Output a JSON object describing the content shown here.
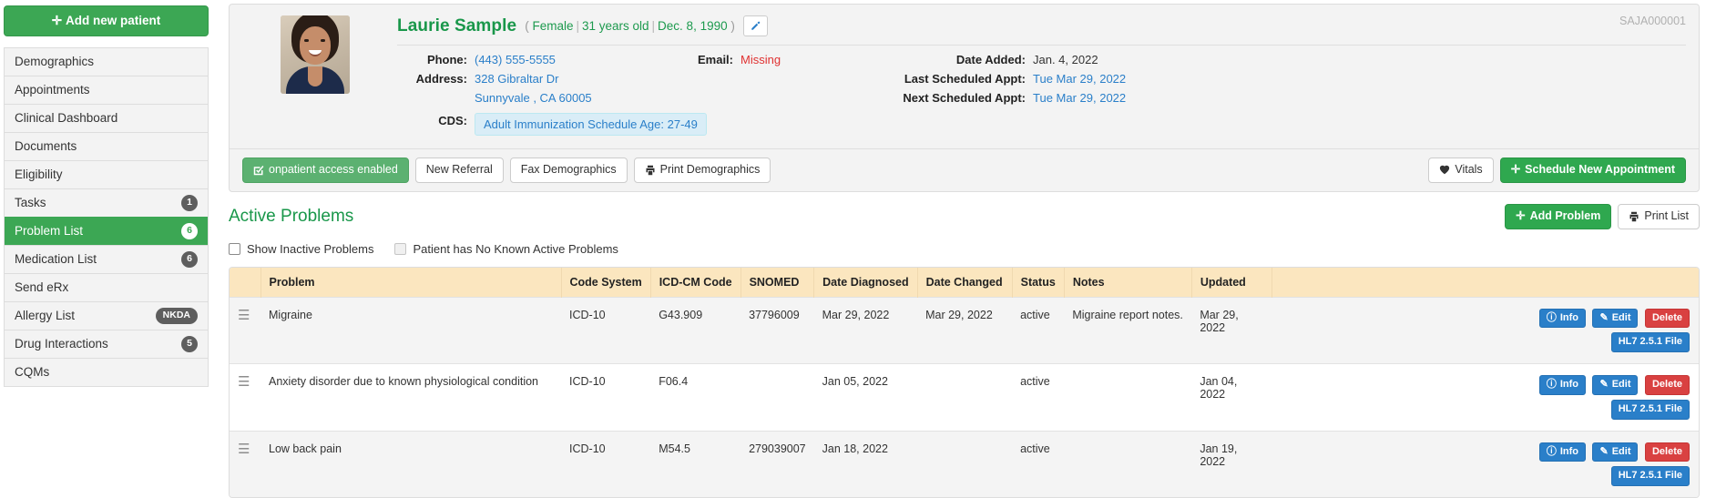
{
  "sidebar": {
    "add_patient_label": "Add new patient",
    "add_patient_plus": "✛",
    "items": [
      {
        "label": "Demographics",
        "badge": "",
        "active": false
      },
      {
        "label": "Appointments",
        "badge": "",
        "active": false
      },
      {
        "label": "Clinical Dashboard",
        "badge": "",
        "active": false
      },
      {
        "label": "Documents",
        "badge": "",
        "active": false
      },
      {
        "label": "Eligibility",
        "badge": "",
        "active": false
      },
      {
        "label": "Tasks",
        "badge": "1",
        "active": false
      },
      {
        "label": "Problem List",
        "badge": "6",
        "active": true
      },
      {
        "label": "Medication List",
        "badge": "6",
        "active": false
      },
      {
        "label": "Send eRx",
        "badge": "",
        "active": false
      },
      {
        "label": "Allergy List",
        "badge": "NKDA",
        "active": false
      },
      {
        "label": "Drug Interactions",
        "badge": "5",
        "active": false
      },
      {
        "label": "CQMs",
        "badge": "",
        "active": false
      }
    ]
  },
  "patient": {
    "name": "Laurie Sample",
    "paren_open": "(",
    "gender": "Female",
    "sep": "|",
    "age": "31 years old",
    "dob": "Dec. 8, 1990",
    "paren_close": ")",
    "chart_id": "SAJA000001",
    "labels": {
      "phone": "Phone:",
      "email": "Email:",
      "address": "Address:",
      "cds": "CDS:",
      "date_added": "Date Added:",
      "last_appt": "Last Scheduled Appt:",
      "next_appt": "Next Scheduled Appt:"
    },
    "phone": "(443) 555-5555",
    "email": "Missing",
    "address_line1": "328 Gibraltar Dr",
    "address_line2": "Sunnyvale , CA 60005",
    "cds": "Adult Immunization Schedule Age: 27-49",
    "date_added": "Jan. 4, 2022",
    "last_appt": "Tue Mar 29, 2022",
    "next_appt": "Tue Mar 29, 2022"
  },
  "actions": {
    "onpatient": "onpatient access enabled",
    "new_referral": "New Referral",
    "fax_demographics": "Fax Demographics",
    "print_demographics": "Print Demographics",
    "vitals": "Vitals",
    "schedule_new_appointment": "Schedule New Appointment"
  },
  "problems_section": {
    "title": "Active Problems",
    "add_problem": "Add Problem",
    "print_list": "Print List",
    "checkbox_show_inactive": "Show Inactive Problems",
    "checkbox_no_known": "Patient has No Known Active Problems"
  },
  "table": {
    "columns": [
      "",
      "Problem",
      "Code System",
      "ICD-CM Code",
      "SNOMED",
      "Date Diagnosed",
      "Date Changed",
      "Status",
      "Notes",
      "Updated",
      ""
    ],
    "rows": [
      {
        "problem": "Migraine",
        "code_system": "ICD-10",
        "icd_cm_code": "G43.909",
        "snomed": "37796009",
        "date_diagnosed": "Mar 29, 2022",
        "date_changed": "Mar 29, 2022",
        "status": "active",
        "notes": "Migraine report notes.",
        "updated": "Mar 29, 2022",
        "buttons": {
          "info": "Info",
          "edit": "Edit",
          "delete": "Delete",
          "hl7": "HL7 2.5.1 File"
        }
      },
      {
        "problem": "Anxiety disorder due to known physiological condition",
        "code_system": "ICD-10",
        "icd_cm_code": "F06.4",
        "snomed": "",
        "date_diagnosed": "Jan 05, 2022",
        "date_changed": "",
        "status": "active",
        "notes": "",
        "updated": "Jan 04, 2022",
        "buttons": {
          "info": "Info",
          "edit": "Edit",
          "delete": "Delete",
          "hl7": "HL7 2.5.1 File"
        }
      },
      {
        "problem": "Low back pain",
        "code_system": "ICD-10",
        "icd_cm_code": "M54.5",
        "snomed": "279039007",
        "date_diagnosed": "Jan 18, 2022",
        "date_changed": "",
        "status": "active",
        "notes": "",
        "updated": "Jan 19, 2022",
        "buttons": {
          "info": "Info",
          "edit": "Edit",
          "delete": "Delete",
          "hl7": "HL7 2.5.1 File"
        }
      }
    ]
  },
  "colors": {
    "green": "#3ca754",
    "link_blue": "#2a7fc9",
    "danger_red": "#d94141",
    "header_tan": "#fbe6bf"
  }
}
